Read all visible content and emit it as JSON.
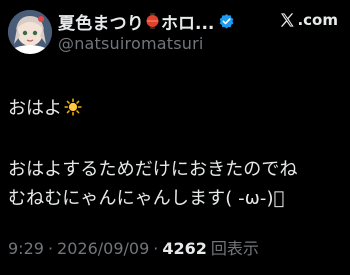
{
  "header": {
    "display_name": "夏色まつり",
    "display_name_rest": "ホロ...",
    "handle": "@natsuiromatsuri",
    "brand": ".com"
  },
  "tweet": {
    "line1": "おはよ",
    "line2": "おはよするためだけにおきたのでね",
    "line3": "むねむにゃんにゃんします(  -ω-)ﾞ"
  },
  "footer": {
    "time": "9:29",
    "separator": "·",
    "date": "2026/09/09",
    "views_count": "4262",
    "views_label": "回表示"
  },
  "colors": {
    "background": "#000000",
    "text": "#e7e9ea",
    "muted": "#71767b",
    "verified": "#1d9bf0"
  },
  "icons": [
    "lantern-icon",
    "verified-badge-icon",
    "x-logo-icon",
    "sun-icon"
  ]
}
